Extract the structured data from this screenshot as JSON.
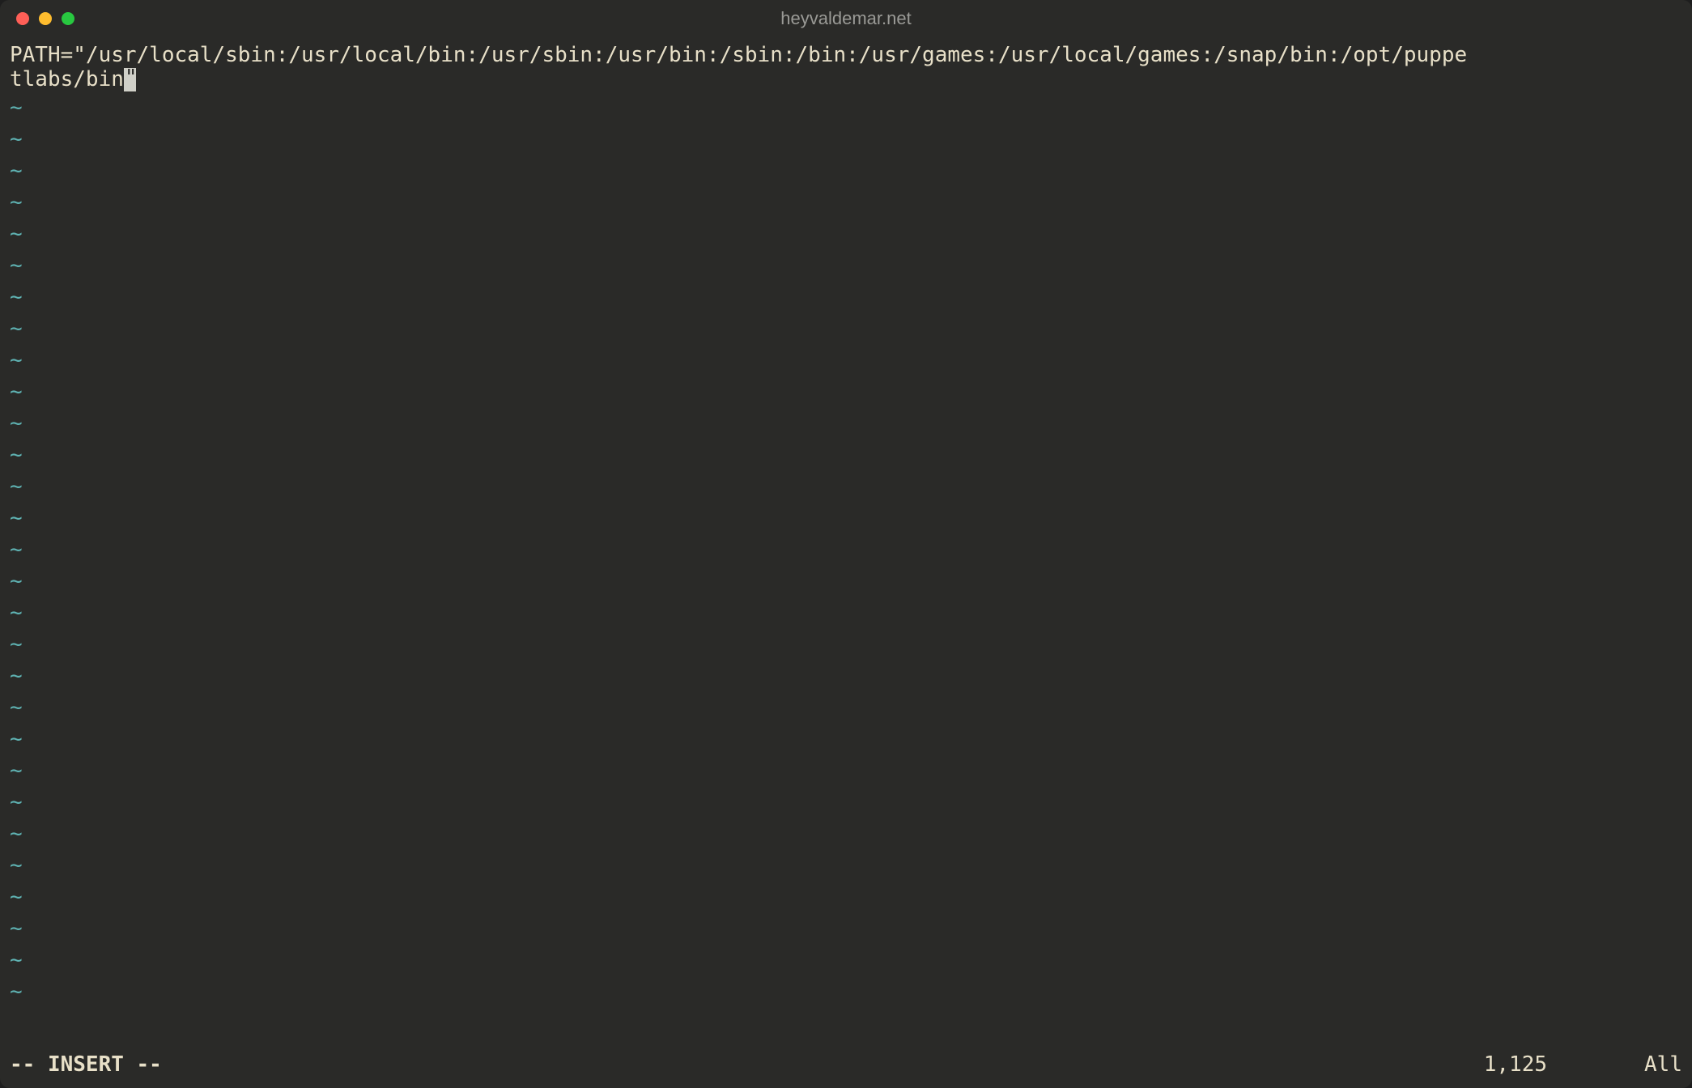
{
  "window": {
    "title": "heyvaldemar.net"
  },
  "editor": {
    "content_line1": "PATH=\"/usr/local/sbin:/usr/local/bin:/usr/sbin:/usr/bin:/sbin:/bin:/usr/games:/usr/local/games:/snap/bin:/opt/puppe",
    "content_line2": "tlabs/bin",
    "cursor_char": "\"",
    "tilde_char": "~",
    "tilde_count": 29
  },
  "status": {
    "mode": "-- INSERT --",
    "position": "1,125",
    "scroll": "All"
  }
}
